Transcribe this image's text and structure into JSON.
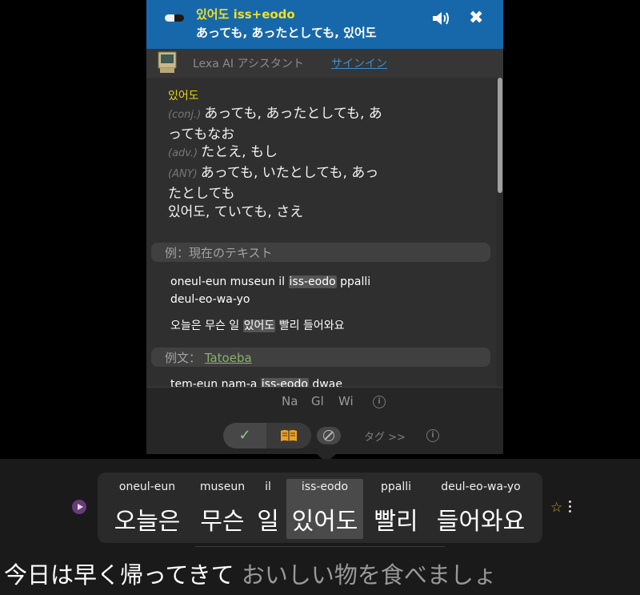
{
  "popup": {
    "header": {
      "word_line": "있어도 iss+eodo",
      "meaning_line": "あっても, あったとしても, 있어도"
    },
    "assistant": {
      "label": "Lexa AI アシスタント",
      "signin": "サインイン"
    },
    "definition": {
      "word": "있어도",
      "entries": [
        {
          "pos": "(conj.)",
          "text_1": "あっても, あったとしても, あ",
          "text_2": "ってもなお"
        },
        {
          "pos": "(adv.)",
          "text_1": "たとえ, もし"
        },
        {
          "pos": "(ANY)",
          "text_1": "あっても, いたとしても, あっ",
          "text_2": "たとしても"
        }
      ],
      "extra_line": "있어도, ていても, さえ"
    },
    "example_current": {
      "title": "例：現在のテキスト",
      "roman_pre": "oneul-eun museun il",
      "roman_hl": "iss-eodo",
      "roman_post": "ppalli",
      "roman_line2": "deul-eo-wa-yo",
      "korean_pre": "오늘은 무슨 일",
      "korean_hl": "있어도",
      "korean_post": "빨리 들어와요"
    },
    "example_sentences": {
      "title": "例文：",
      "source": "Tatoeba",
      "partial_roman_pre": "tem-eun nam-a",
      "partial_roman_hl": "iss-eodo",
      "partial_roman_post": "dwae"
    },
    "footer": {
      "dicts": [
        "Na",
        "Gl",
        "Wi"
      ],
      "tag_label": "タグ >>"
    }
  },
  "subtitle": {
    "tokens": [
      {
        "roman": "oneul-eun",
        "korean": "오늘은"
      },
      {
        "roman": "museun",
        "korean": "무슨"
      },
      {
        "roman": "il",
        "korean": "일"
      },
      {
        "roman": "iss-eodo",
        "korean": "있어도"
      },
      {
        "roman": "ppalli",
        "korean": "빨리"
      },
      {
        "roman": "deul-eo-wa-yo",
        "korean": "들어와요"
      }
    ],
    "translation_main": "今日は早く帰ってきて",
    "translation_dim": "おいしい物を食べましょ"
  },
  "colors": {
    "header_bg": "#1768ab",
    "word_yellow": "#f0e020",
    "link_blue": "#3a8fd0",
    "tatoeba_green": "#8bb26a",
    "star_gold": "#c8a42a"
  },
  "icons": [
    "pill-icon",
    "speaker-icon",
    "close-icon",
    "computer-icon",
    "info-icon",
    "check-icon",
    "book-icon",
    "block-icon",
    "play-icon",
    "star-icon",
    "more-vertical-icon"
  ]
}
